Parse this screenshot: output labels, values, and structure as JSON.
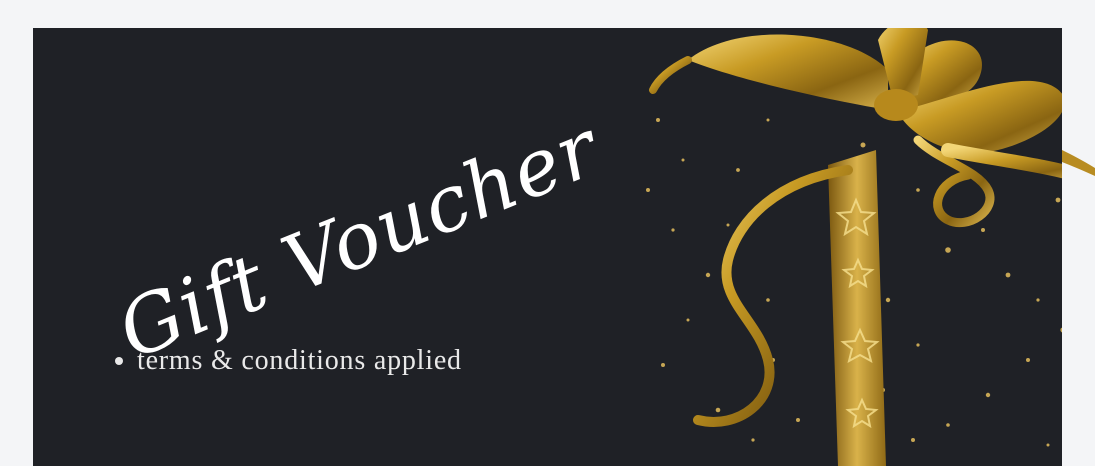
{
  "voucher": {
    "title": "Gift Voucher",
    "terms": "terms & conditions applied"
  },
  "colors": {
    "page_background": "#f4f5f7",
    "card_background": "#1f2126",
    "text": "#ffffff",
    "ribbon_gold": "#c9a227"
  },
  "icons": {
    "decoration": "gold-ribbon-bow-illustration"
  }
}
